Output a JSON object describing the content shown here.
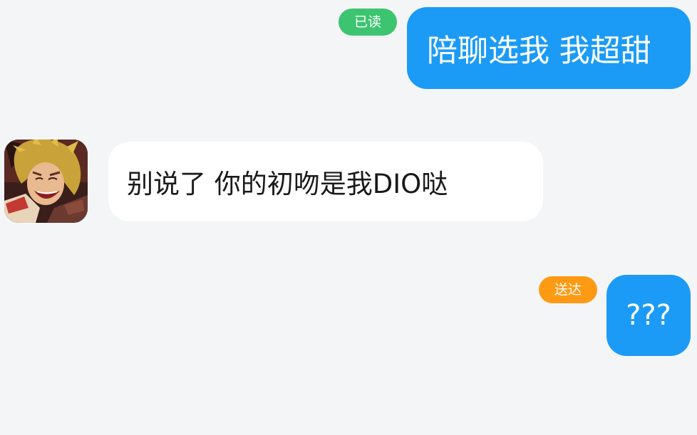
{
  "messages": [
    {
      "direction": "outgoing",
      "text": "陪聊选我  我超甜",
      "status": "已读",
      "status_color": "#3cc470"
    },
    {
      "direction": "incoming",
      "text": "别说了  你的初吻是我DIO哒",
      "avatar_icon": "character-avatar-icon"
    },
    {
      "direction": "outgoing",
      "text": "???",
      "status": "送达",
      "status_color": "#ff9a14"
    }
  ],
  "colors": {
    "background": "#f4f5f7",
    "outgoing_bubble": "#1b9bf5",
    "incoming_bubble": "#ffffff"
  }
}
